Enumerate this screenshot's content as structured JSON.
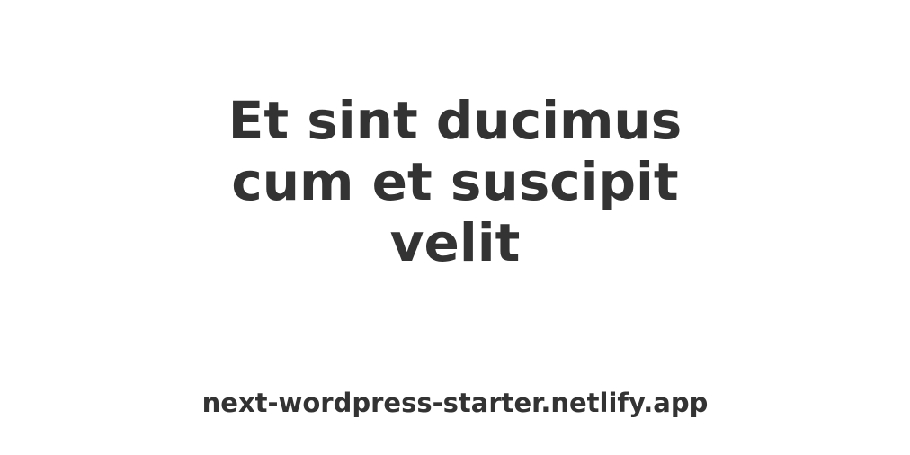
{
  "post": {
    "title_lines": [
      "Et sint ducimus",
      "cum et suscipit",
      "velit"
    ]
  },
  "site": {
    "url": "next-wordpress-starter.netlify.app"
  },
  "colors": {
    "background": "#ffffff",
    "text": "#333333"
  }
}
